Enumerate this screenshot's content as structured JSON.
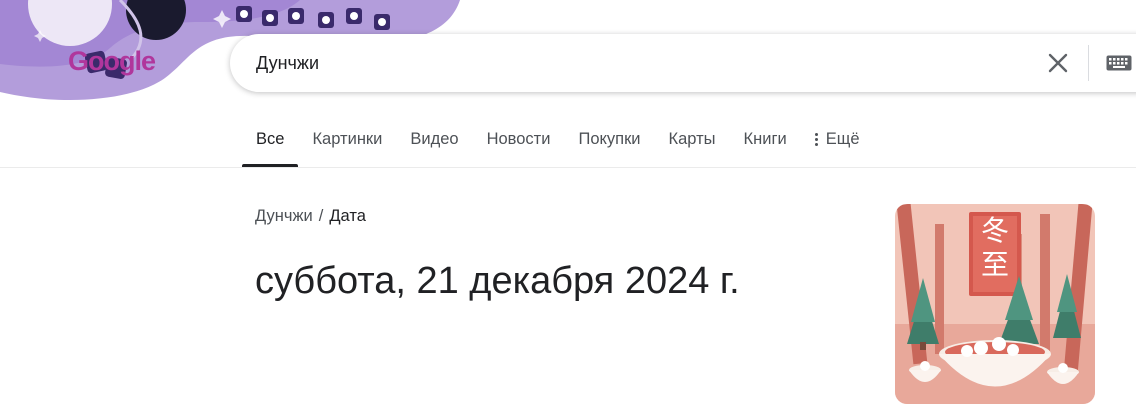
{
  "logo": {
    "text": "Google"
  },
  "search": {
    "query": "Дунчжи"
  },
  "icons": {
    "clear": "close-icon",
    "keyboard": "keyboard-icon",
    "more": "more-vert-icon"
  },
  "tabs": [
    {
      "label": "Все",
      "active": true
    },
    {
      "label": "Картинки"
    },
    {
      "label": "Видео"
    },
    {
      "label": "Новости"
    },
    {
      "label": "Покупки"
    },
    {
      "label": "Карты"
    },
    {
      "label": "Книги"
    },
    {
      "label": "Ещё"
    }
  ],
  "result": {
    "breadcrumb": {
      "topic": "Дунчжи",
      "separator": "/",
      "attribute": "Дата"
    },
    "answer": "суббота, 21 декабря 2024 г."
  },
  "thumbnail": {
    "characters": "冬至"
  },
  "colors": {
    "accent": "#202124",
    "secondary_text": "#4d5156",
    "doodle_purple": "#b39ddb",
    "thumbnail_pink": "#e8a89a"
  }
}
